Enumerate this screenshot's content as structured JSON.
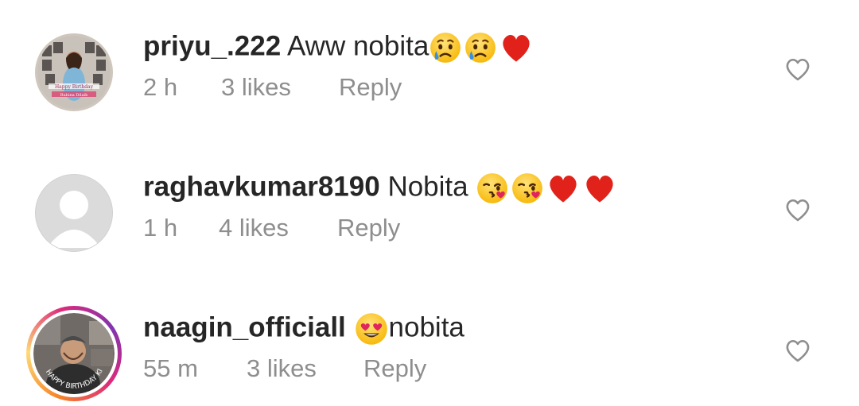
{
  "comments": [
    {
      "username": "priyu_.222",
      "text": "Aww nobita",
      "time": "2 h",
      "likes": "3 likes",
      "reply": "Reply",
      "emojis": [
        "crying-face",
        "crying-face",
        "red-heart"
      ],
      "avatar_caption_1": "Happy Birthday",
      "avatar_caption_2": "Rubina Dilaik"
    },
    {
      "username": "raghavkumar8190",
      "text": "Nobita",
      "time": "1 h",
      "likes": "4 likes",
      "reply": "Reply",
      "emojis": [
        "kissing-face",
        "kissing-face",
        "red-heart",
        "red-heart"
      ]
    },
    {
      "username": "naagin_officiall",
      "text": "nobita",
      "time": "55 m",
      "likes": "3 likes",
      "reply": "Reply",
      "emojis": [
        "heart-eyes-face"
      ],
      "avatar_caption": "HAPPY BIRTHDAY KING"
    }
  ],
  "colors": {
    "text": "#262626",
    "secondary": "#8e8e8e",
    "heart": "#e0245e",
    "icon_outline": "#8e8e8e"
  }
}
